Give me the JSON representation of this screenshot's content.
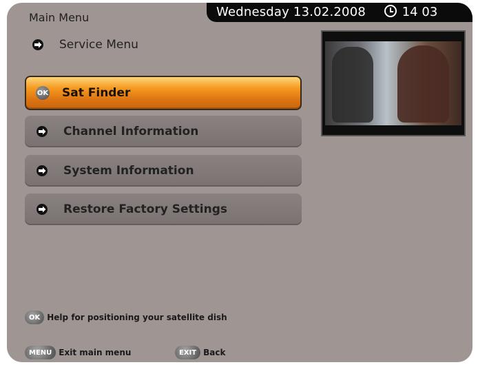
{
  "header": {
    "title": "Main Menu",
    "date": "Wednesday 13.02.2008",
    "time": "14 03"
  },
  "service": {
    "label": "Service Menu"
  },
  "menu": {
    "items": [
      {
        "label": "Sat Finder",
        "badge": "OK"
      },
      {
        "label": "Channel Information"
      },
      {
        "label": "System Information"
      },
      {
        "label": "Restore Factory Settings"
      }
    ]
  },
  "help": {
    "badge": "OK",
    "text": "Help for positioning your satellite dish"
  },
  "footer": {
    "menu_key": "MENU",
    "menu_text": "Exit main menu",
    "exit_key": "EXIT",
    "exit_text": "Back"
  },
  "colors": {
    "background": "#9f9593",
    "selected": "#f59a20",
    "topbar": "#0b0b0b"
  }
}
